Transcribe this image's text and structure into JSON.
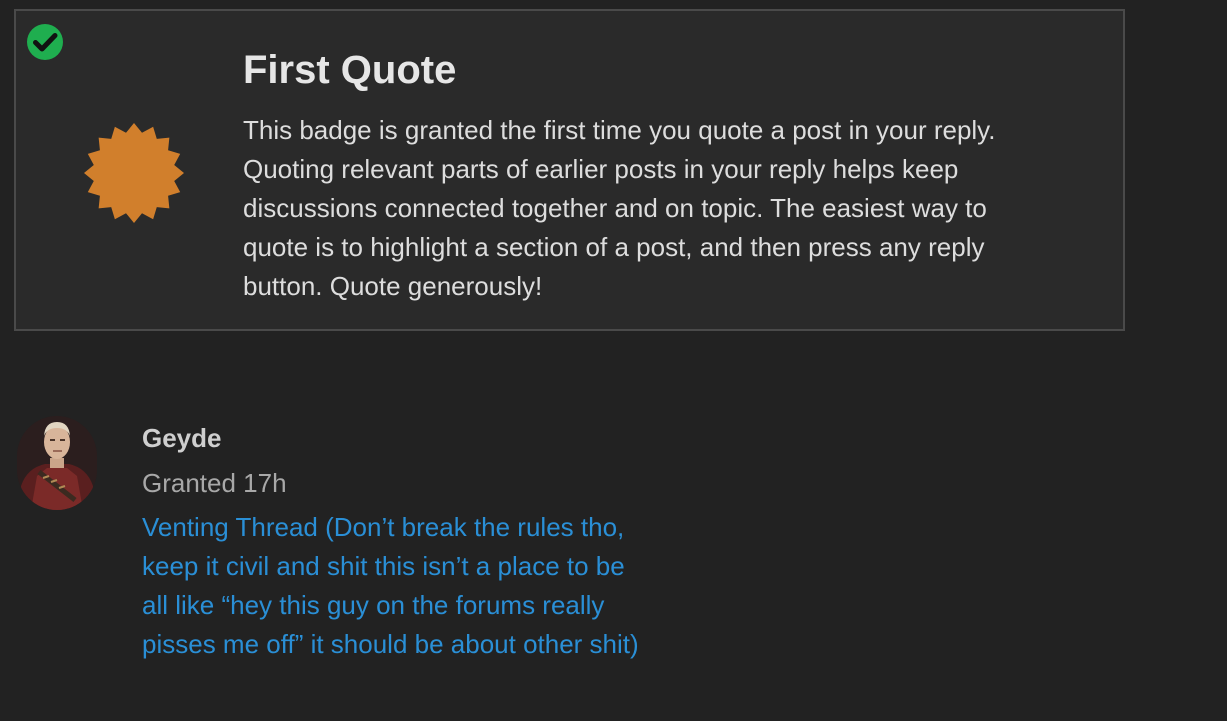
{
  "badge": {
    "title": "First Quote",
    "description": "This badge is granted the first time you quote a post in your reply. Quoting relevant parts of earlier posts in your reply helps keep discussions connected together and on topic. The easiest way to quote is to highlight a section of a post, and then press any reply button. Quote generously!",
    "icon": "badge-certificate-icon",
    "granted_icon": "check-circle-icon",
    "colors": {
      "badge_icon": "#d17f2c",
      "check": "#1fae4f"
    }
  },
  "grant": {
    "username": "Geyde",
    "granted_label": "Granted 17h",
    "topic_title": "Venting Thread (Don’t break the rules tho, keep it civil and shit this isn’t a place to be all like “hey this guy on the forums really pisses me off” it should be about other shit)",
    "avatar": "user-avatar"
  },
  "colors": {
    "background": "#222222",
    "card_background": "#2a2a2a",
    "link": "#2a8fd6"
  }
}
